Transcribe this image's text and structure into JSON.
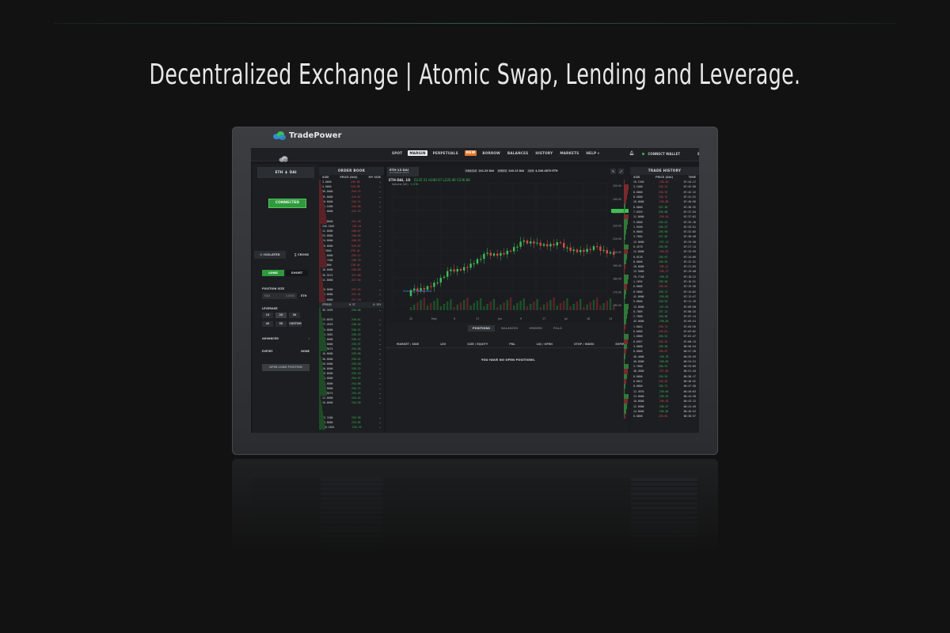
{
  "headline": "Decentralized Exchange | Atomic Swap, Lending and Leverage.",
  "brand": {
    "name": "TradePower"
  },
  "nav": {
    "items": [
      "SPOT",
      "MARGIN",
      "PERPETUALS",
      "BORROW",
      "BALANCES",
      "HISTORY",
      "MARKETS",
      "HELP ▾"
    ],
    "active": "MARGIN",
    "new_badge": "NEW",
    "connect_wallet": "CONNECT WALLET",
    "lang": "EN"
  },
  "left": {
    "pair_base": "ETH",
    "pair_quote": "DAI",
    "connected": "CONNECTED",
    "tab_isolated": "◎ ISOLATED",
    "tab_cross": "∑ CROSS",
    "long": "LONG",
    "short": "SHORT",
    "position_size_label": "POSITION SIZE",
    "position_size_placeholder": "MAX",
    "position_size_value": "0.0000",
    "position_size_unit": "ETH",
    "leverage_label": "LEVERAGE",
    "leverage_options": [
      "1X",
      "2X",
      "3X",
      "4X",
      "5X",
      "CUSTOM"
    ],
    "leverage_selected": "2X",
    "advanced": "ADVANCED",
    "expiry_label": "EXPIRY",
    "expiry_value": "NONE",
    "open_button": "OPEN LONG POSITION"
  },
  "orderbook": {
    "title": "ORDER BOOK",
    "cols": [
      "SIZE",
      "PRICE (DAI)",
      "MY SIZE"
    ],
    "asks": [
      [
        "3.0000",
        "245.05",
        "—"
      ],
      [
        "4.0000",
        "244.98",
        "—"
      ],
      [
        "36.0000",
        "244.75",
        "—"
      ],
      [
        "45.0000",
        "243.87",
        "—"
      ],
      [
        "40.0000",
        "243.21",
        "—"
      ],
      [
        "45.1000",
        "242.88",
        "—"
      ],
      [
        "26.0000",
        "242.33",
        "—"
      ],
      [
        "",
        "",
        ""
      ],
      [
        "10.0000",
        "241.96",
        "—"
      ],
      [
        "256.2849",
        "241.44",
        "—"
      ],
      [
        "12.0000",
        "240.87",
        "—"
      ],
      [
        "25.0000",
        "240.66",
        "—"
      ],
      [
        "24.0000",
        "240.31",
        "—"
      ],
      [
        "10.0000",
        "239.82",
        "—"
      ],
      [
        "0.5000",
        "239.44",
        "—"
      ],
      [
        "90.0000",
        "239.12",
        "—"
      ],
      [
        "58.7500",
        "238.76",
        "—"
      ],
      [
        "5.0000",
        "238.44",
        "—"
      ],
      [
        "10.0000",
        "238.09",
        "—"
      ],
      [
        "36.9474",
        "237.88",
        "—"
      ],
      [
        "11.0000",
        "237.66",
        "—"
      ],
      [
        "",
        "",
        ""
      ],
      [
        "36.0000",
        "237.45",
        "—"
      ],
      [
        "10.0000",
        "237.31",
        "—"
      ],
      [
        "25.0000",
        "237.20",
        "—"
      ]
    ],
    "spread_label": "SPREAD",
    "spread_value": "0.37",
    "spread_pct": "0.15%",
    "bids": [
      [
        "36.3499",
        "236.88",
        "—"
      ],
      [
        "",
        "",
        ""
      ],
      [
        "13.0078",
        "236.61",
        "—"
      ],
      [
        "77.4559",
        "236.54",
        "—"
      ],
      [
        "15.0000",
        "236.41",
        "—"
      ],
      [
        "84.3681",
        "236.25",
        "—"
      ],
      [
        "10.0000",
        "236.12",
        "—"
      ],
      [
        "36.0000",
        "235.97",
        "—"
      ],
      [
        "36.9474",
        "235.80",
        "—"
      ],
      [
        "10.0000",
        "235.66",
        "—"
      ],
      [
        "30.0000",
        "235.51",
        "—"
      ],
      [
        "26.0000",
        "235.40",
        "—"
      ],
      [
        "10.0000",
        "235.22",
        "—"
      ],
      [
        "36.0000",
        "235.10",
        "—"
      ],
      [
        "28.0000",
        "234.97",
        "—"
      ],
      [
        "35.0000",
        "234.88",
        "—"
      ],
      [
        "10.0000",
        "234.71",
        "—"
      ],
      [
        "36.9474",
        "234.55",
        "—"
      ],
      [
        "12.0000",
        "234.41",
        "—"
      ],
      [
        "10.0000",
        "234.30",
        "—"
      ],
      [
        "",
        "",
        ""
      ],
      [
        "",
        "",
        ""
      ],
      [
        "43.7400",
        "233.98",
        "—"
      ],
      [
        "13.0000",
        "233.85",
        "—"
      ],
      [
        "206.2645",
        "233.70",
        "—"
      ]
    ]
  },
  "market": {
    "pair": "ETH-13 DAI",
    "sub": "DAI MARKET PRICE",
    "stat1_label": "ORACLE",
    "stat1_value": "241.20 DAI",
    "stat2_label": "INDEX",
    "stat2_value": "240.13 DAI",
    "stat3_label": "24H",
    "stat3_value": "4,340.4870 ETH",
    "chart_title": "ETH-DAI, 1D",
    "ohlc": "O235.51 H240.67 L235.06 C236.86",
    "volume": "Volume (20)",
    "volume_value": "1.27K",
    "watermark": "Chart by TradingView",
    "x_ticks": [
      "22",
      "May",
      "9",
      "17",
      "Jun",
      "9",
      "17",
      "Jul",
      "18",
      "13"
    ],
    "y_ticks": [
      "250.00",
      "245.00",
      "240.00",
      "235.00",
      "230.00",
      "225.00",
      "220.00",
      "215.00",
      "210.00",
      "205.00",
      "200.00",
      "195.00",
      "190.00",
      "185.00",
      "180.00",
      "175.00",
      "170.00",
      "165.00",
      "160.00",
      "155.00"
    ]
  },
  "positions": {
    "tabs": [
      "POSITIONS",
      "BALANCES",
      "ORDERS",
      "FILLS"
    ],
    "active": "POSITIONS",
    "cols": [
      "MARKET / SIDE",
      "LEV",
      "SIZE / EQUITY",
      "PNL",
      "LIQ / OPEN",
      "STOP / INDEX",
      "EXPIRY"
    ],
    "empty": "YOU HAVE NO OPEN POSITIONS."
  },
  "trades": {
    "title": "TRADE HISTORY",
    "cols": [
      "SIZE",
      "PRICE (DAI)",
      "TIME"
    ],
    "rows": [
      [
        "16.1340",
        "236.30",
        "r",
        "07:44:17"
      ],
      [
        "3.1400",
        "236.51",
        "r",
        "07:42:56"
      ],
      [
        "8.0000",
        "236.55",
        "r",
        "07:42:12"
      ],
      [
        "8.5000",
        "236.72",
        "r",
        "07:41:31"
      ],
      [
        "16.0000",
        "236.88",
        "r",
        "07:40:56"
      ],
      [
        "8.0000",
        "237.36",
        "g",
        "07:38:32"
      ],
      [
        "7.0359",
        "236.80",
        "g",
        "07:37:54"
      ],
      [
        "11.0000",
        "236.44",
        "r",
        "07:37:02"
      ],
      [
        "9.0000",
        "236.61",
        "g",
        "07:35:16"
      ],
      [
        "1.9490",
        "236.57",
        "g",
        "07:33:51"
      ],
      [
        "8.0000",
        "236.90",
        "g",
        "07:32:05"
      ],
      [
        "3.7604",
        "237.02",
        "g",
        "07:30:48"
      ],
      [
        "12.0000",
        "237.11",
        "g",
        "07:29:36"
      ],
      [
        "0.4278",
        "236.95",
        "g",
        "07:27:14"
      ],
      [
        "11.0000",
        "236.83",
        "r",
        "07:25:59"
      ],
      [
        "0.0138",
        "236.67",
        "g",
        "07:24:09"
      ],
      [
        "8.0000",
        "236.55",
        "g",
        "07:22:31"
      ],
      [
        "10.0000",
        "236.41",
        "r",
        "07:21:05"
      ],
      [
        "13.5000",
        "236.27",
        "r",
        "07:19:48"
      ],
      [
        "76.7748",
        "236.33",
        "g",
        "07:18:22"
      ],
      [
        "1.1694",
        "236.48",
        "g",
        "07:16:51"
      ],
      [
        "6.0000",
        "236.61",
        "r",
        "07:15:30"
      ],
      [
        "8.5000",
        "236.72",
        "g",
        "07:14:02"
      ],
      [
        "41.0000",
        "236.85",
        "g",
        "07:12:47"
      ],
      [
        "9.8000",
        "236.93",
        "g",
        "07:11:19"
      ],
      [
        "12.0000",
        "237.01",
        "g",
        "07:09:58"
      ],
      [
        "8.7889",
        "237.12",
        "g",
        "07:08:33"
      ],
      [
        "2.7000",
        "236.98",
        "g",
        "07:07:14"
      ],
      [
        "45.0000",
        "236.84",
        "g",
        "07:05:41"
      ],
      [
        "1.8044",
        "236.73",
        "r",
        "07:04:26"
      ],
      [
        "6.0000",
        "236.61",
        "r",
        "07:03:02"
      ],
      [
        "1.0000",
        "236.52",
        "g",
        "07:01:47"
      ],
      [
        "6.6957",
        "236.44",
        "r",
        "07:00:13"
      ],
      [
        "3.0000",
        "236.58",
        "g",
        "06:58:54"
      ],
      [
        "8.0000",
        "236.67",
        "r",
        "06:57:28"
      ],
      [
        "40.4000",
        "236.76",
        "g",
        "06:55:59"
      ],
      [
        "40.6000",
        "236.89",
        "g",
        "06:54:31"
      ],
      [
        "3.7000",
        "236.97",
        "g",
        "06:53:09"
      ],
      [
        "48.4000",
        "237.05",
        "r",
        "06:51:44"
      ],
      [
        "8.0000",
        "236.93",
        "g",
        "06:50:17"
      ],
      [
        "6.8021",
        "236.82",
        "r",
        "06:48:52"
      ],
      [
        "8.0000",
        "236.71",
        "g",
        "06:47:30"
      ],
      [
        "12.4970",
        "236.60",
        "g",
        "06:46:03"
      ],
      [
        "13.0000",
        "236.49",
        "g",
        "06:44:38"
      ],
      [
        "10.0000",
        "236.38",
        "r",
        "06:43:12"
      ],
      [
        "12.8980",
        "236.47",
        "g",
        "06:41:49"
      ],
      [
        "14.0000",
        "236.56",
        "g",
        "06:40:22"
      ],
      [
        "8.0000",
        "236.65",
        "r",
        "06:38:57"
      ]
    ]
  }
}
